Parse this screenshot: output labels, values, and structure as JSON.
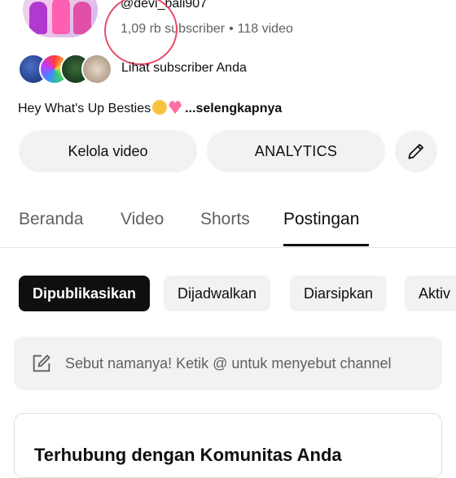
{
  "channel": {
    "handle": "@devi_bali907",
    "subscribers": "1,09 rb subscriber",
    "separator": "•",
    "videos": "118 video",
    "see_subscribers": "Lihat subscriber Anda",
    "description_text": "Hey What's Up Besties",
    "description_more": "...selengkapnya"
  },
  "actions": {
    "manage_videos": "Kelola video",
    "analytics": "ANALYTICS",
    "edit_icon": "pencil-icon"
  },
  "tabs": [
    {
      "label": "Beranda",
      "active": false
    },
    {
      "label": "Video",
      "active": false
    },
    {
      "label": "Shorts",
      "active": false
    },
    {
      "label": "Postingan",
      "active": true
    }
  ],
  "filters": [
    {
      "label": "Dipublikasikan",
      "selected": true
    },
    {
      "label": "Dijadwalkan",
      "selected": false
    },
    {
      "label": "Diarsipkan",
      "selected": false
    },
    {
      "label": "Aktiv",
      "selected": false
    }
  ],
  "composer": {
    "placeholder": "Sebut namanya! Ketik @ untuk menyebut channel",
    "icon": "edit-icon"
  },
  "community_card": {
    "title": "Terhubung dengan Komunitas Anda"
  },
  "colors": {
    "annotation_circle": "#e94a6a",
    "chip_selected": "#0f0f0f",
    "chip_bg": "#f2f2f2"
  }
}
